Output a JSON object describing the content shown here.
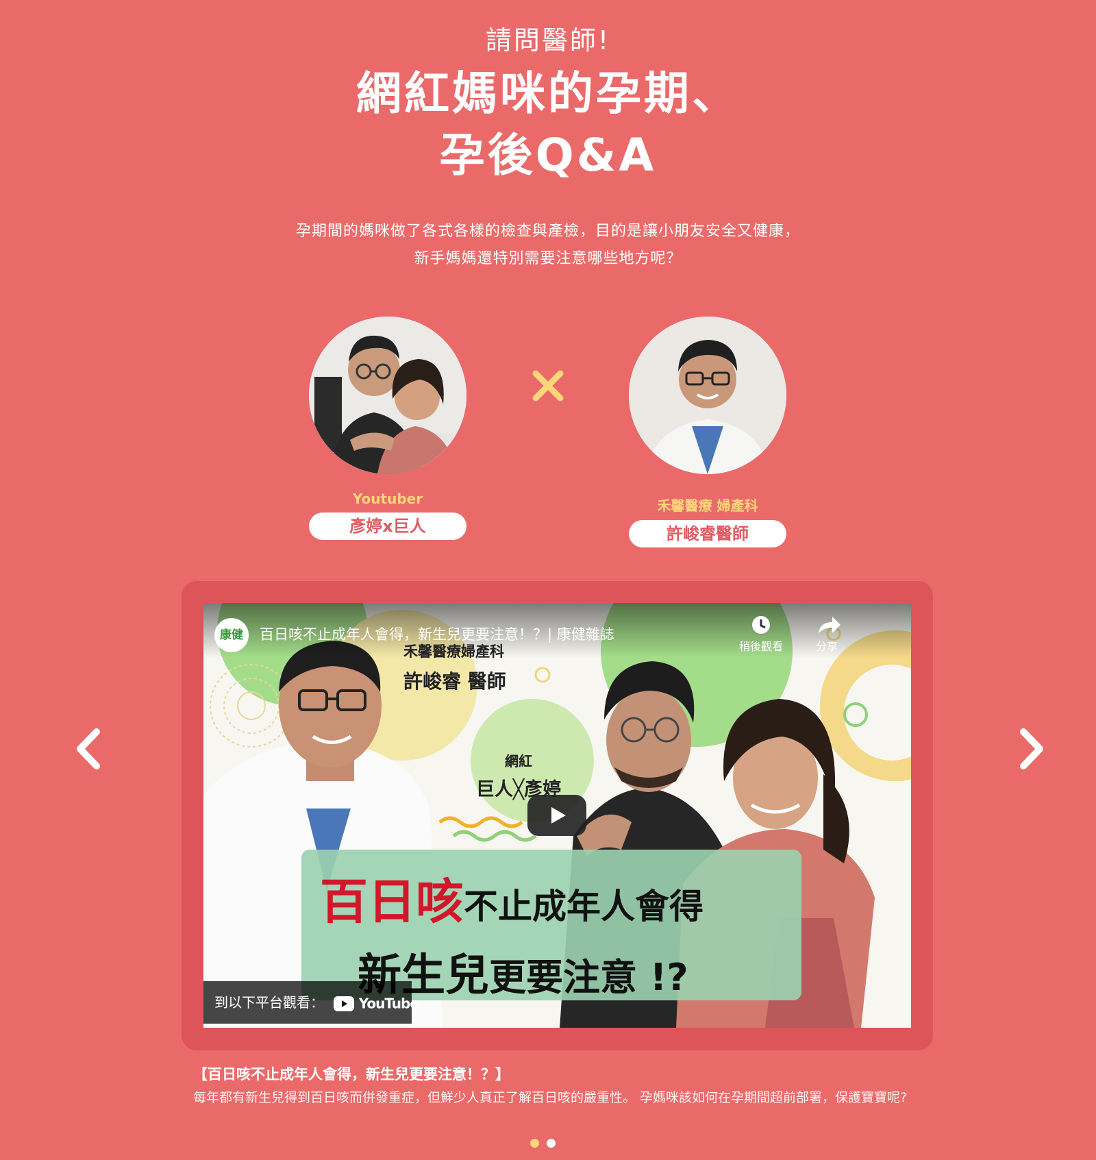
{
  "header": {
    "kicker": "請問醫師!",
    "title_line1": "網紅媽咪的孕期、",
    "title_line2": "孕後Q&A",
    "intro_line1": "孕期間的媽咪做了各式各樣的檢查與產檢，目的是讓小朋友安全又健康，",
    "intro_line2": "新手媽媽還特別需要注意哪些地方呢？"
  },
  "guests": [
    {
      "role": "Youtuber",
      "name": "彥婷x巨人"
    },
    {
      "role": "禾馨醫療 婦產科",
      "name": "許峻睿醫師"
    }
  ],
  "video": {
    "channel_logo_text": "康健",
    "title": "百日咳不止成年人會得，新生兒更要注意！？| 康健雜誌",
    "watch_later": "稍後觀看",
    "share": "分享",
    "doctor_line1": "禾馨醫療婦產科",
    "doctor_line2": "許峻睿 醫師",
    "influencer_line1": "網紅",
    "influencer_line2": "巨人╳彥婷",
    "headline_red": "百日咳",
    "headline_rest": "不止成年人會得",
    "headline2_big": "新生兒",
    "headline2_mid": "更要注意 !?",
    "watch_on": "到以下平台觀看：",
    "youtube": "YouTube"
  },
  "caption": {
    "title": "【百日咳不止成年人會得，新生兒更要注意！？】",
    "description": "每年都有新生兒得到百日咳而併發重症，但鮮少人真正了解百日咳的嚴重性。 孕媽咪該如何在孕期間超前部署，保護寶寶呢?"
  },
  "carousel": {
    "current_slide": 1,
    "total_slides": 2
  },
  "colors": {
    "background": "#ea6a6a",
    "frame": "#dd5559",
    "accent_yellow": "#ffd57a",
    "pill_text": "#e05c63",
    "headline_red": "#d2172a"
  },
  "icons": [
    "times-icon",
    "chevron-left-icon",
    "chevron-right-icon",
    "play-icon",
    "clock-icon",
    "share-icon",
    "youtube-icon"
  ]
}
